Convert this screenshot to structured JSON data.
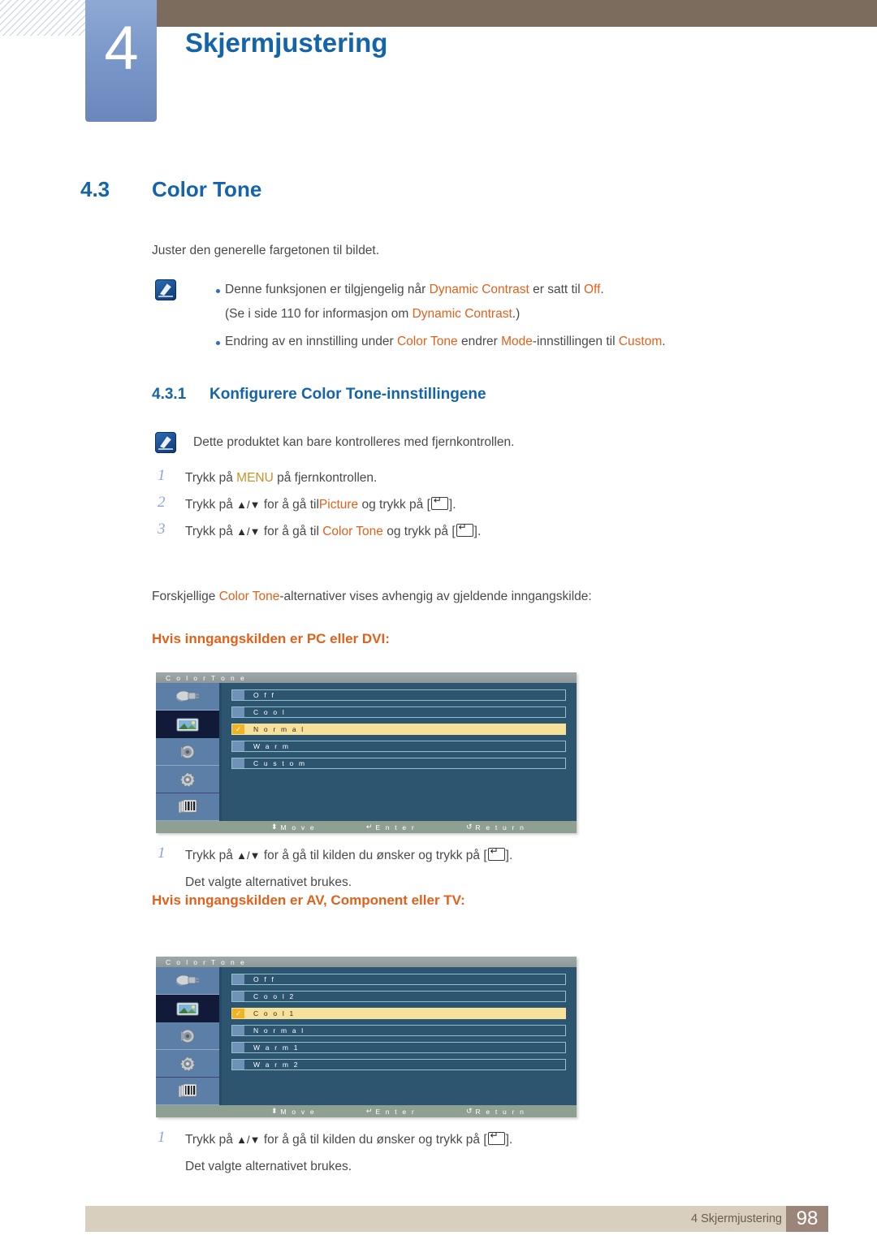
{
  "header": {
    "chapter_number": "4",
    "chapter_title": "Skjermjustering"
  },
  "section": {
    "number": "4.3",
    "title": "Color Tone",
    "intro": "Juster den generelle fargetonen til bildet."
  },
  "note_top": {
    "bullet1_a": "Denne funksjonen er tilgjengelig når ",
    "bullet1_b": "Dynamic Contrast",
    "bullet1_c": " er satt til ",
    "bullet1_d": "Off",
    "bullet1_e": ".",
    "bullet1_line2_a": "(Se i side 110 for informasjon om ",
    "bullet1_line2_b": "Dynamic Contrast",
    "bullet1_line2_c": ".)",
    "bullet2_a": "Endring av en innstilling under ",
    "bullet2_b": "Color Tone",
    "bullet2_c": " endrer ",
    "bullet2_d": "Mode",
    "bullet2_e": "-innstillingen til ",
    "bullet2_f": "Custom",
    "bullet2_g": "."
  },
  "subsection": {
    "number": "4.3.1",
    "title": "Konfigurere Color Tone-innstillingene",
    "note": "Dette produktet kan bare kontrolleres med fjernkontrollen."
  },
  "steps": [
    {
      "num": "1",
      "a": "Trykk på ",
      "hi": "MENU",
      "b": " på fjernkontrollen.",
      "hi_class": "gold"
    },
    {
      "num": "2",
      "a": "Trykk på ",
      "arrows": "▲/▼",
      "b": " for å gå til",
      "hi": "Picture",
      "c": " og trykk på [",
      "d": "]."
    },
    {
      "num": "3",
      "a": "Trykk på ",
      "arrows": "▲/▼",
      "b": " for å gå til ",
      "hi": "Color Tone",
      "c": " og trykk på [",
      "d": "]."
    }
  ],
  "variants_line": {
    "a": "Forskjellige ",
    "hi": "Color Tone",
    "b": "-alternativer vises avhengig av gjeldende inngangskilde:"
  },
  "osd_pc": {
    "heading": "Hvis inngangskilden er PC eller DVI:",
    "title": "C o l o r  T o n e",
    "sidebar_icons": [
      "input-source-icon",
      "picture-icon",
      "sound-icon",
      "setup-gear-icon",
      "multi-control-icon"
    ],
    "active_sidebar_index": 1,
    "rows": [
      {
        "label": "O f f",
        "selected": false
      },
      {
        "label": "C o o l",
        "selected": false
      },
      {
        "label": "N o r m a l",
        "selected": true
      },
      {
        "label": "W a r m",
        "selected": false
      },
      {
        "label": "C u s t o m",
        "selected": false
      }
    ],
    "footer": [
      {
        "glyph": "⬍",
        "label": "M o v e"
      },
      {
        "glyph": "↵",
        "label": "E n t e r"
      },
      {
        "glyph": "↺",
        "label": "R e t u r n"
      }
    ],
    "step": {
      "num": "1",
      "a": "Trykk på ",
      "arrows": "▲/▼",
      "b": " for å gå til kilden du ønsker og trykk på [",
      "c": "].",
      "sub": "Det valgte alternativet brukes."
    }
  },
  "osd_av": {
    "heading": "Hvis inngangskilden er AV, Component eller TV:",
    "title": "C o l o r  T o n e",
    "sidebar_icons": [
      "input-source-icon",
      "picture-icon",
      "sound-icon",
      "setup-gear-icon",
      "multi-control-icon"
    ],
    "active_sidebar_index": 1,
    "rows": [
      {
        "label": "O f f",
        "selected": false
      },
      {
        "label": "C o o l 2",
        "selected": false
      },
      {
        "label": "C o o l 1",
        "selected": true
      },
      {
        "label": "N o r m a l",
        "selected": false
      },
      {
        "label": "W a r m 1",
        "selected": false
      },
      {
        "label": "W a r m 2",
        "selected": false
      }
    ],
    "footer": [
      {
        "glyph": "⬍",
        "label": "M o v e"
      },
      {
        "glyph": "↵",
        "label": "E n t e r"
      },
      {
        "glyph": "↺",
        "label": "R e t u r n"
      }
    ],
    "step": {
      "num": "1",
      "a": "Trykk på ",
      "arrows": "▲/▼",
      "b": " for å gå til kilden du ønsker og trykk på [",
      "c": "].",
      "sub": "Det valgte alternativet brukes."
    }
  },
  "footer": {
    "text": "4 Skjermjustering",
    "page": "98"
  },
  "colors": {
    "accent_blue": "#1464ab",
    "accent_orange": "#e2601a",
    "gold": "#c8922a",
    "header_brown": "#7b6c5d",
    "footer_bar": "#d9cfbe",
    "page_box": "#9b8578",
    "osd_bg": "#2d5570",
    "osd_selected": "#f6e09a"
  }
}
